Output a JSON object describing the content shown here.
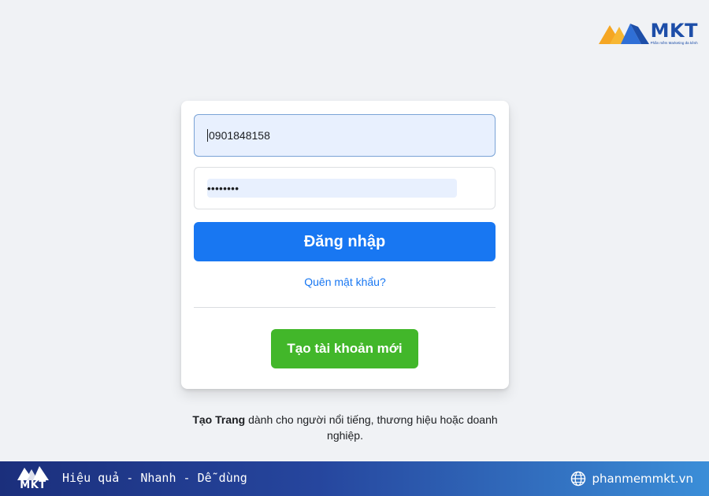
{
  "brand": {
    "name": "MKT",
    "tagline": "Phần mềm Marketing đa kênh"
  },
  "login": {
    "phone_value": "0901848158",
    "password_mask": "••••••••",
    "login_label": "Đăng nhập",
    "forgot_label": "Quên mật khẩu?",
    "create_label": "Tạo tài khoản mới"
  },
  "page_note": {
    "bold": "Tạo Trang",
    "rest": " dành cho người nổi tiếng, thương hiệu hoặc doanh nghiệp."
  },
  "banner": {
    "logo_text": "MKT",
    "slogan": "Hiệu quả - Nhanh - Dễ dùng",
    "website": "phanmemmkt.vn"
  },
  "colors": {
    "primary": "#1877f2",
    "create": "#42b72a",
    "brand_blue": "#1d4ea8",
    "brand_orange": "#f5a623"
  },
  "icons": [
    "mkt-logo-icon",
    "globe-icon"
  ]
}
